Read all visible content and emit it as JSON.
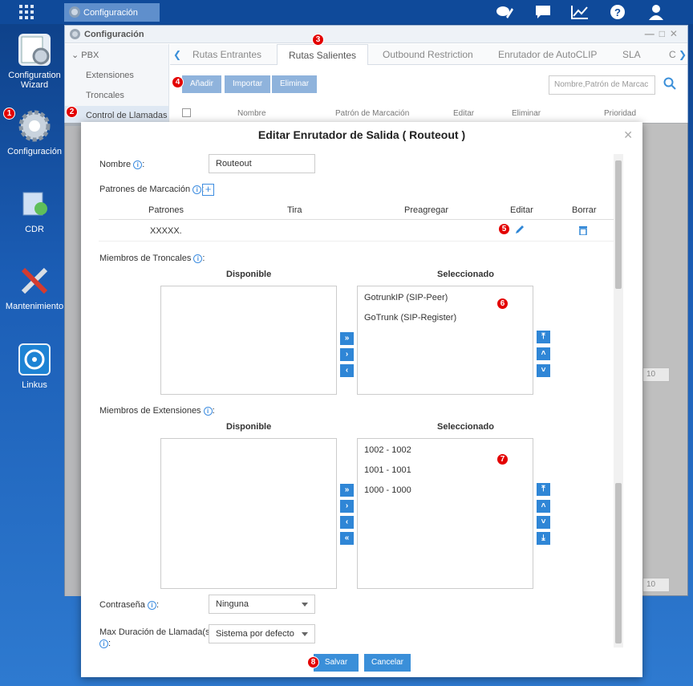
{
  "taskbar": {
    "app_label": "Configuración"
  },
  "desktop": {
    "icons": [
      {
        "label": "Configuration Wizard",
        "badge": ""
      },
      {
        "label": "Configuración",
        "badge": "1"
      },
      {
        "label": "CDR",
        "badge": ""
      },
      {
        "label": "Mantenimiento",
        "badge": ""
      },
      {
        "label": "Linkus",
        "badge": ""
      }
    ]
  },
  "window": {
    "title": "Configuración",
    "sidebar": {
      "section": "PBX",
      "items": [
        "Extensiones",
        "Troncales",
        "Control de Llamadas"
      ],
      "active_badge": "2"
    },
    "tabs": [
      "Rutas Entrantes",
      "Rutas Salientes",
      "Outbound Restriction",
      "Enrutador de AutoCLIP",
      "SLA",
      "C"
    ],
    "active_tab_badge": "3",
    "toolbar": {
      "badge": "4",
      "add": "Añadir",
      "import": "Importar",
      "delete": "Eliminar"
    },
    "search_placeholder": "Nombre,Patrón de Marcac",
    "table_headers": [
      "Nombre",
      "Patrón de Marcación",
      "Editar",
      "Eliminar",
      "Prioridad"
    ],
    "pager_value": "10"
  },
  "dialog": {
    "title": "Editar Enrutador de Salida ( Routeout )",
    "name_label": "Nombre",
    "name_value": "Routeout",
    "patterns_label": "Patrones de Marcación",
    "patterns_headers": [
      "Patrones",
      "Tira",
      "Preagregar",
      "Editar",
      "Borrar"
    ],
    "patterns_rows": [
      {
        "pattern": "XXXXX.",
        "strip": "",
        "prepend": ""
      }
    ],
    "edit_badge": "5",
    "trunks_label": "Miembros de Troncales",
    "available_label": "Disponible",
    "selected_label": "Seleccionado",
    "trunks_available": [],
    "trunks_selected": [
      "GotrunkIP (SIP-Peer)",
      "GoTrunk (SIP-Register)"
    ],
    "trunks_badge": "6",
    "ext_label": "Miembros de Extensiones",
    "ext_available": [],
    "ext_selected": [
      "1002 - 1002",
      "1001 - 1001",
      "1000 - 1000"
    ],
    "ext_badge": "7",
    "password_label": "Contraseña",
    "password_value": "Ninguna",
    "maxdur_label": "Max Duración de Llamada(s)",
    "maxdur_value": "Sistema por defecto",
    "save": "Salvar",
    "cancel": "Cancelar",
    "save_badge": "8"
  },
  "colors": {
    "accent": "#3a8fd9",
    "badge": "#e30000",
    "desktop": "#1b5db5"
  }
}
